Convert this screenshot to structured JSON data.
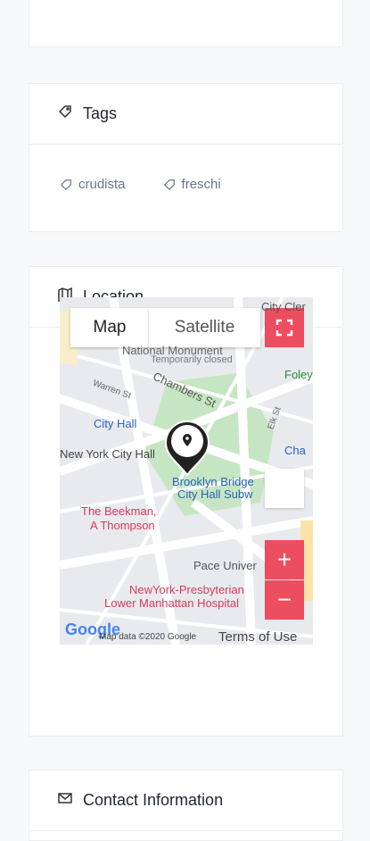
{
  "tags_card": {
    "title": "Tags",
    "items": [
      "crudista",
      "freschi"
    ]
  },
  "location_card": {
    "title": "Location",
    "map": {
      "tab_map": "Map",
      "tab_satellite": "Satellite",
      "zoom_in": "+",
      "zoom_out": "−",
      "labels": {
        "city_hall": "City Hall",
        "new_york_city_hall": "New York City Hall",
        "brooklyn_bridge": "Brooklyn Bridge",
        "city_hall_subway": "City Hall Subw",
        "beekman": "The Beekman,",
        "thompson": "A Thompson",
        "pace": "Pace Univer",
        "presbyterian": "NewYork-Presbyterian",
        "lower_manhattan": "Lower Manhattan Hospital",
        "national_monument": "National Monument",
        "temporarily_closed": "Temporarily closed",
        "chambers_st": "Chambers St",
        "warren_st": "Warren St",
        "foley": "Foley",
        "cha": "Cha",
        "city_cler": "City Cler",
        "elk_st": "Elk St"
      },
      "google": "Google",
      "attribution": "Map data ©2020 Google",
      "terms": "Terms of Use"
    }
  },
  "contact_card": {
    "title": "Contact Information"
  }
}
